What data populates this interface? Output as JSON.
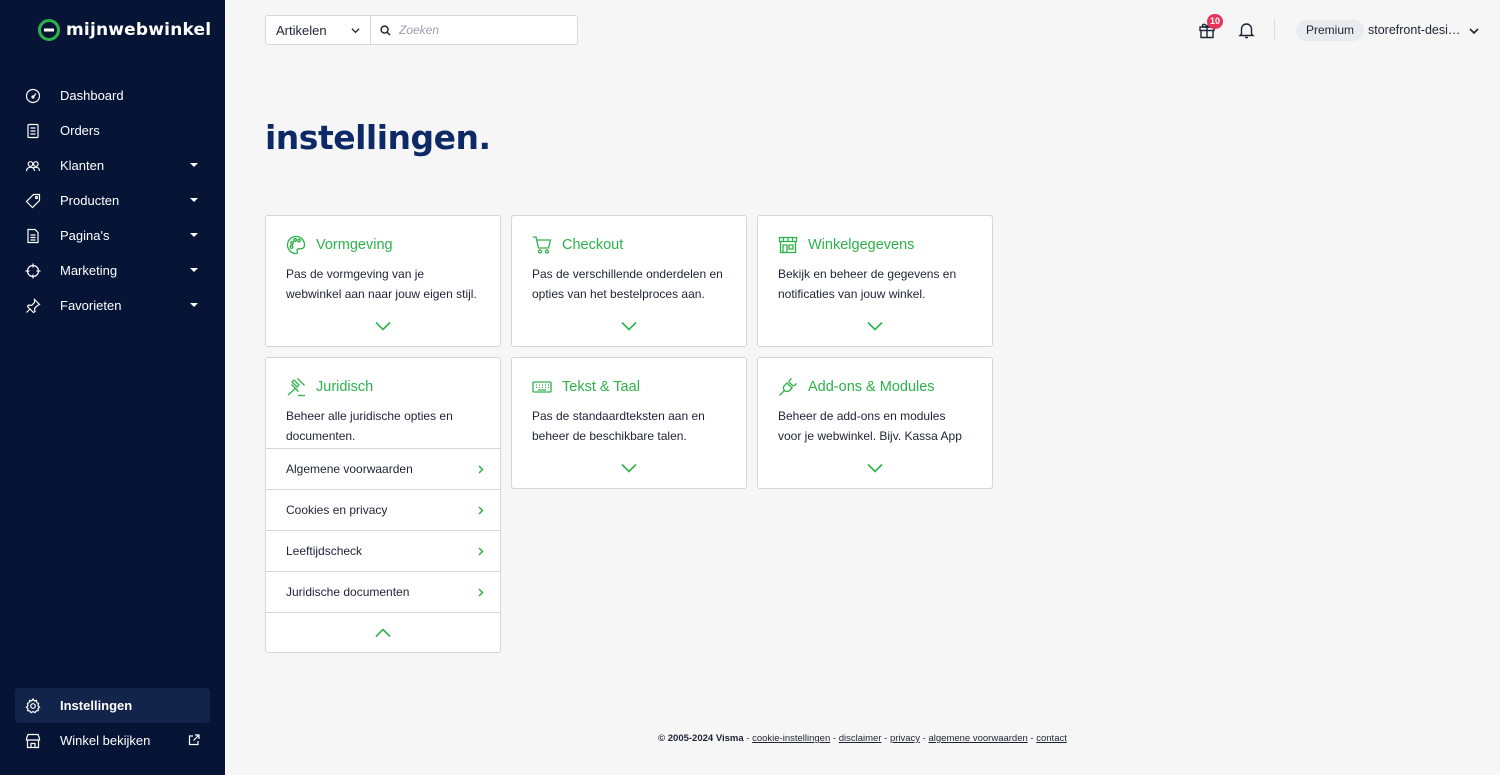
{
  "logo": {
    "text": "mijnwebwinkel"
  },
  "sidebar": {
    "items": [
      {
        "label": "Dashboard",
        "icon": "dashboard-icon",
        "has_dropdown": false
      },
      {
        "label": "Orders",
        "icon": "orders-icon",
        "has_dropdown": false
      },
      {
        "label": "Klanten",
        "icon": "customers-icon",
        "has_dropdown": true
      },
      {
        "label": "Producten",
        "icon": "tag-icon",
        "has_dropdown": true
      },
      {
        "label": "Pagina's",
        "icon": "page-icon",
        "has_dropdown": true
      },
      {
        "label": "Marketing",
        "icon": "target-icon",
        "has_dropdown": true
      },
      {
        "label": "Favorieten",
        "icon": "pin-icon",
        "has_dropdown": true
      }
    ],
    "bottom": [
      {
        "label": "Instellingen",
        "icon": "gear-icon",
        "active": true
      },
      {
        "label": "Winkel bekijken",
        "icon": "store-icon",
        "external": true
      }
    ]
  },
  "topbar": {
    "search_scope": "Artikelen",
    "search_placeholder": "Zoeken",
    "notification_count": "10",
    "plan": "Premium",
    "store_name": "storefront-design-test"
  },
  "page": {
    "title": "instellingen."
  },
  "cards": [
    {
      "title": "Vormgeving",
      "icon": "palette-icon",
      "description": "Pas de vormgeving van je webwinkel aan naar jouw eigen stijl."
    },
    {
      "title": "Checkout",
      "icon": "cart-icon",
      "description": "Pas de verschillende onderdelen en opties van het bestelproces aan."
    },
    {
      "title": "Winkelgegevens",
      "icon": "shop-icon",
      "description": "Bekijk en beheer de gegevens en notificaties van jouw winkel."
    },
    {
      "title": "Juridisch",
      "icon": "gavel-icon",
      "description": "Beheer alle juridische opties en documenten.",
      "links": [
        "Algemene voorwaarden",
        "Cookies en privacy",
        "Leeftijdscheck",
        "Juridische documenten"
      ]
    },
    {
      "title": "Tekst & Taal",
      "icon": "keyboard-icon",
      "description": "Pas de standaardteksten aan en beheer de beschikbare talen."
    },
    {
      "title": "Add-ons & Modules",
      "icon": "plug-icon",
      "description": "Beheer de add-ons en modules voor je webwinkel. Bijv. Kassa App"
    }
  ],
  "footer": {
    "copyright": "© 2005-2024 Visma",
    "links": [
      "cookie-instellingen",
      "disclaimer",
      "privacy",
      "algemene voorwaarden",
      "contact"
    ]
  },
  "colors": {
    "sidebar_bg": "#061536",
    "accent_green": "#2db24a",
    "title_blue": "#0d2a66",
    "badge_red": "#e9345a"
  }
}
